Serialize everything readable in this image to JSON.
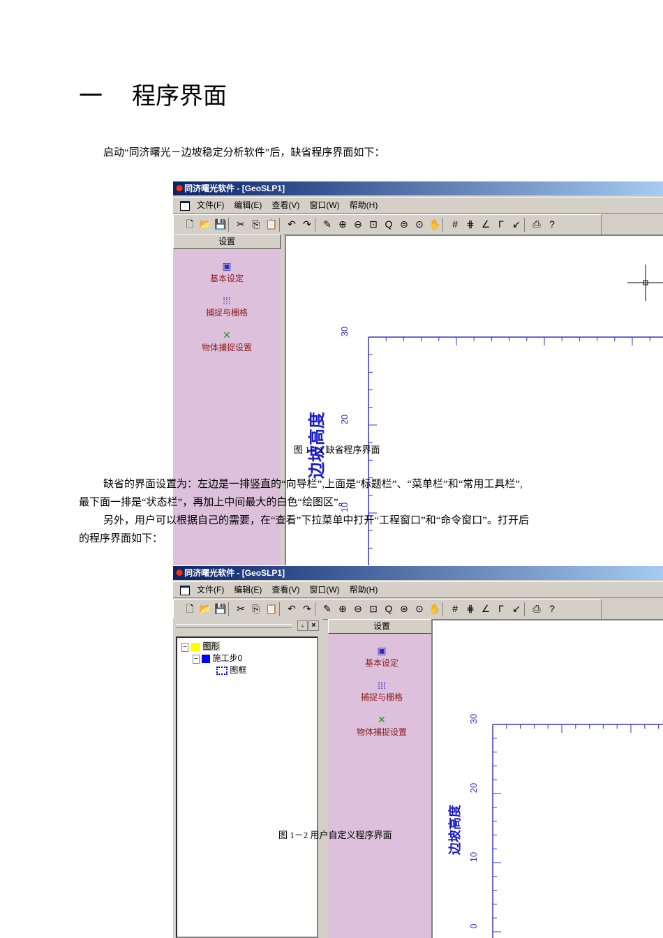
{
  "heading": {
    "number": "一",
    "title": "程序界面"
  },
  "intro": "启动“同济曙光－边坡稳定分析软件”后，缺省程序界面如下：",
  "app": {
    "title": "同济曙光软件 - [GeoSLP1]",
    "menu": [
      "文件(F)",
      "编辑(E)",
      "查看(V)",
      "窗口(W)",
      "帮助(H)"
    ],
    "toolbar_icons": [
      "new-icon",
      "open-icon",
      "save-icon",
      "cut-icon",
      "copy-icon",
      "paste-icon",
      "undo-icon",
      "redo-icon",
      "draw-icon",
      "zoom-in-icon",
      "zoom-out-icon",
      "zoom-window-icon",
      "zoom-realtime-icon",
      "zoom-extents-icon",
      "zoom-previous-icon",
      "pan-icon",
      "grid-icon",
      "snap-grid-icon",
      "angle-icon",
      "ortho-icon",
      "object-snap-icon",
      "print-icon",
      "help-icon"
    ],
    "sidebar_header": "设置",
    "sidebar_items": [
      "基本设定",
      "捕捉与栅格",
      "物体捕捉设置"
    ],
    "ylabel": "边坡高度",
    "yticks_fig1": [
      "30",
      "20",
      "10"
    ],
    "yticks_fig2": [
      "30",
      "20",
      "10",
      "0"
    ],
    "tree": [
      "图形",
      "施工步0",
      "图框"
    ]
  },
  "fig1_caption": "图 1－1  缺省程序界面",
  "para1_line1": "缺省的界面设置为：左边是一排竖直的“向导栏”,上面是“标题栏”、“菜单栏”和“常用工具栏”,",
  "para1_line2": "最下面一排是“状态栏”，再加上中间最大的白色“绘图区”。",
  "para2_line1": "另外，用户可以根据自己的需要，在“查看”下拉菜单中打开“工程窗口”和“命令窗口”。打开后",
  "para2_line2": "的程序界面如下：",
  "fig2_caption": "图 1－2  用户自定义程序界面",
  "colors": {
    "sidebar": "#dcc0dc",
    "axis": "#3333cc",
    "titlebar": "#0a246a"
  }
}
